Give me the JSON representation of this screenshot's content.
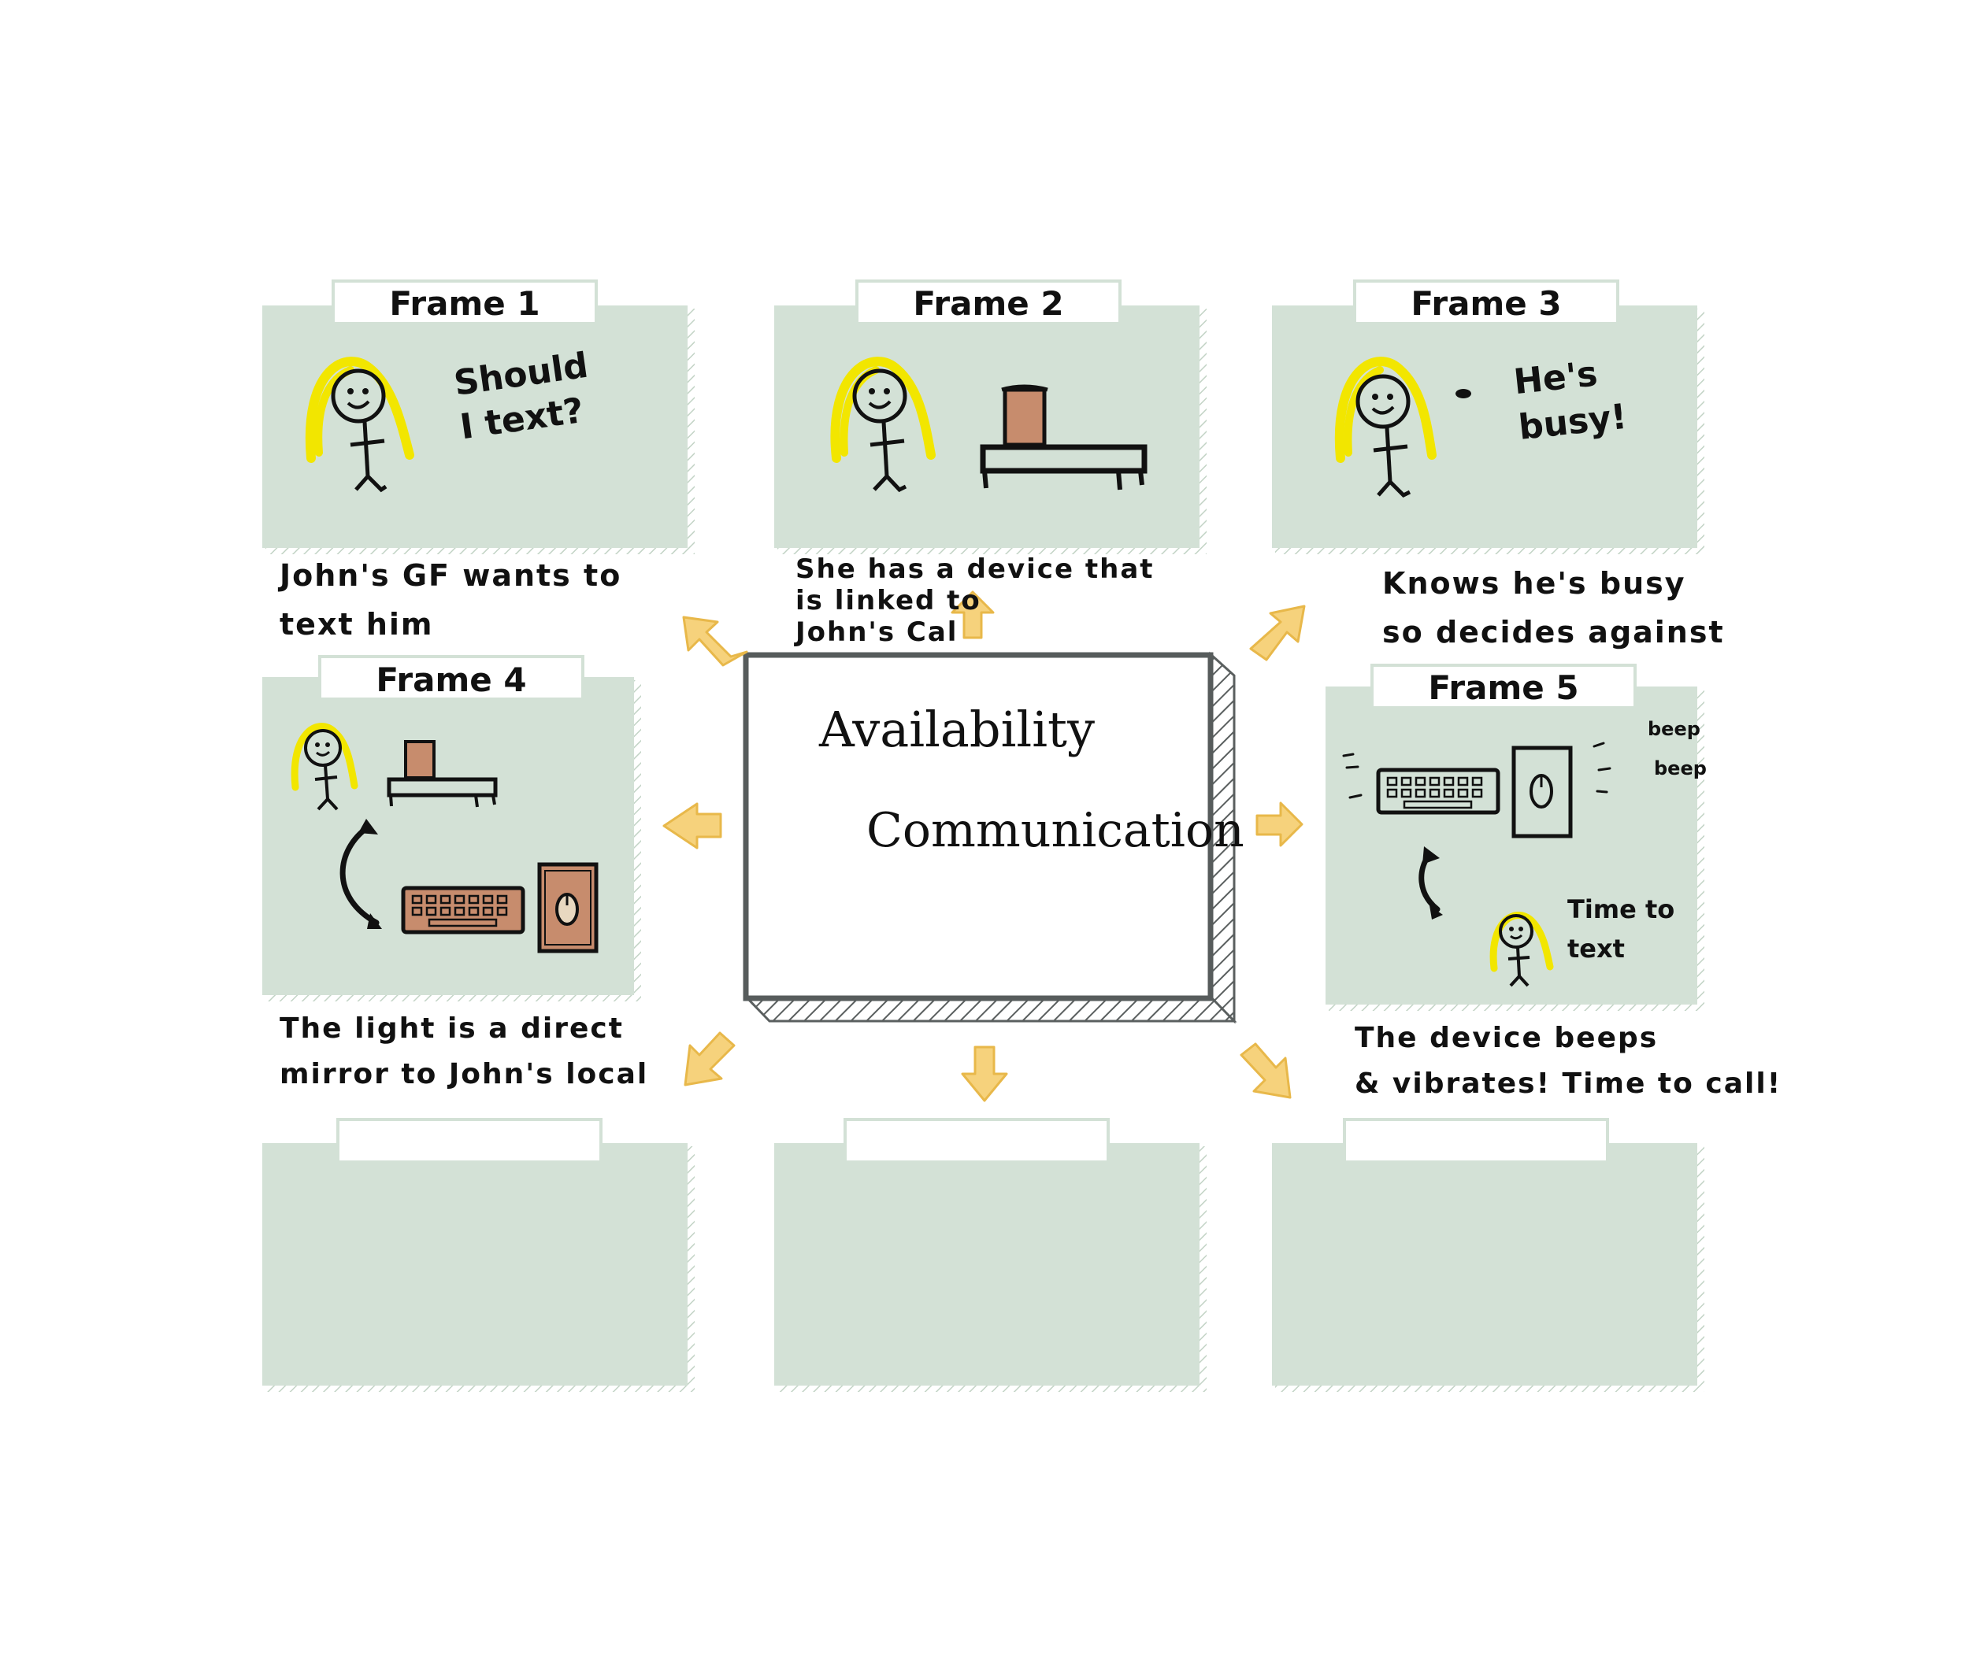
{
  "colors": {
    "panel": "#d3e1d6",
    "panel_edge": "#c2d3c5",
    "tab": "#ffffff",
    "arrow": "#f6d27c",
    "arrow_edge": "#e8b84a",
    "hair": "#f2e600",
    "device": "#c78c6d",
    "ink": "#111111"
  },
  "center": {
    "line1": "Availability",
    "line2": "Communication"
  },
  "frames": [
    {
      "title": "Frame 1",
      "speech": "Should\nI text?",
      "caption": "John's GF wants to\n  text him"
    },
    {
      "title": "Frame 2",
      "speech": "",
      "caption": "She has a device that\n        is linked to\n        John's Cal"
    },
    {
      "title": "Frame 3",
      "speech": "He's\n busy!",
      "caption": "Knows he's busy\n so decides against"
    },
    {
      "title": "Frame 4",
      "speech": "",
      "caption": "The light is a direct\nmirror to John's local"
    },
    {
      "title": "Frame 5",
      "speech": "Time to\n  text",
      "caption": "The device beeps\n& vibrates! Time to call!"
    }
  ],
  "frame5_sounds": [
    "beep",
    "beep"
  ],
  "empty_frames": [
    {
      "title": ""
    },
    {
      "title": ""
    },
    {
      "title": ""
    }
  ]
}
